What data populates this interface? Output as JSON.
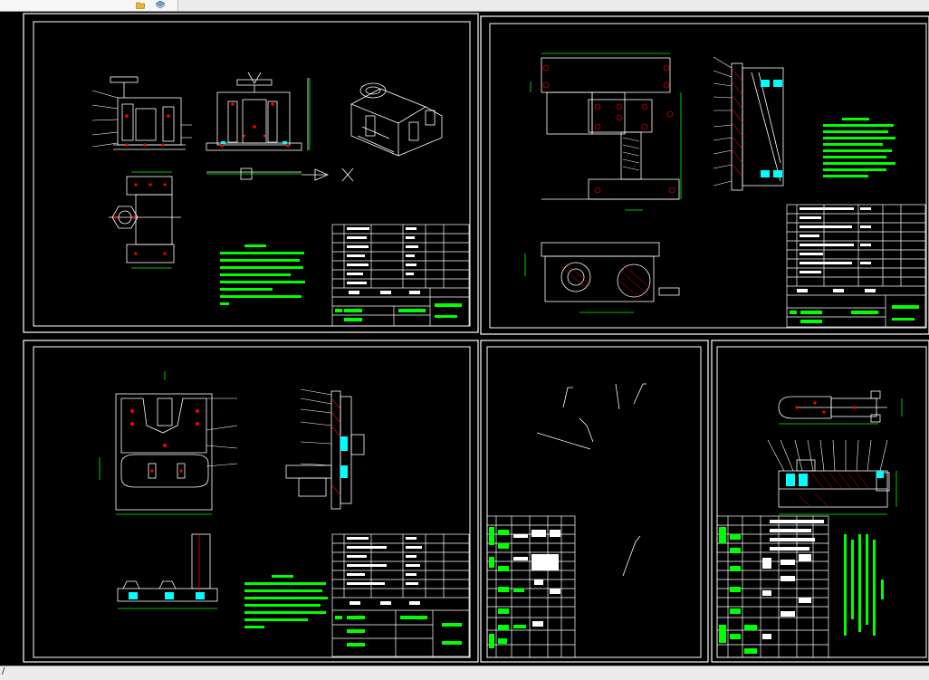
{
  "app": {
    "toolbar_icons": [
      "folder-open-icon",
      "layer-icon"
    ],
    "status_text": "/"
  },
  "colors": {
    "background": "#000000",
    "border": "#ffffff",
    "accent": "#00ff00",
    "cyan": "#00ffff",
    "red": "#ff0000",
    "yellow": "#ffff00"
  },
  "sheets": [
    {
      "id": "sheet-1",
      "title_block_rows": 9
    },
    {
      "id": "sheet-2",
      "title_block_rows": 9
    },
    {
      "id": "sheet-3",
      "title_block_rows": 9
    },
    {
      "id": "sheet-4",
      "title_block_rows": 9
    },
    {
      "id": "sheet-5",
      "title_block_rows": 9
    }
  ]
}
